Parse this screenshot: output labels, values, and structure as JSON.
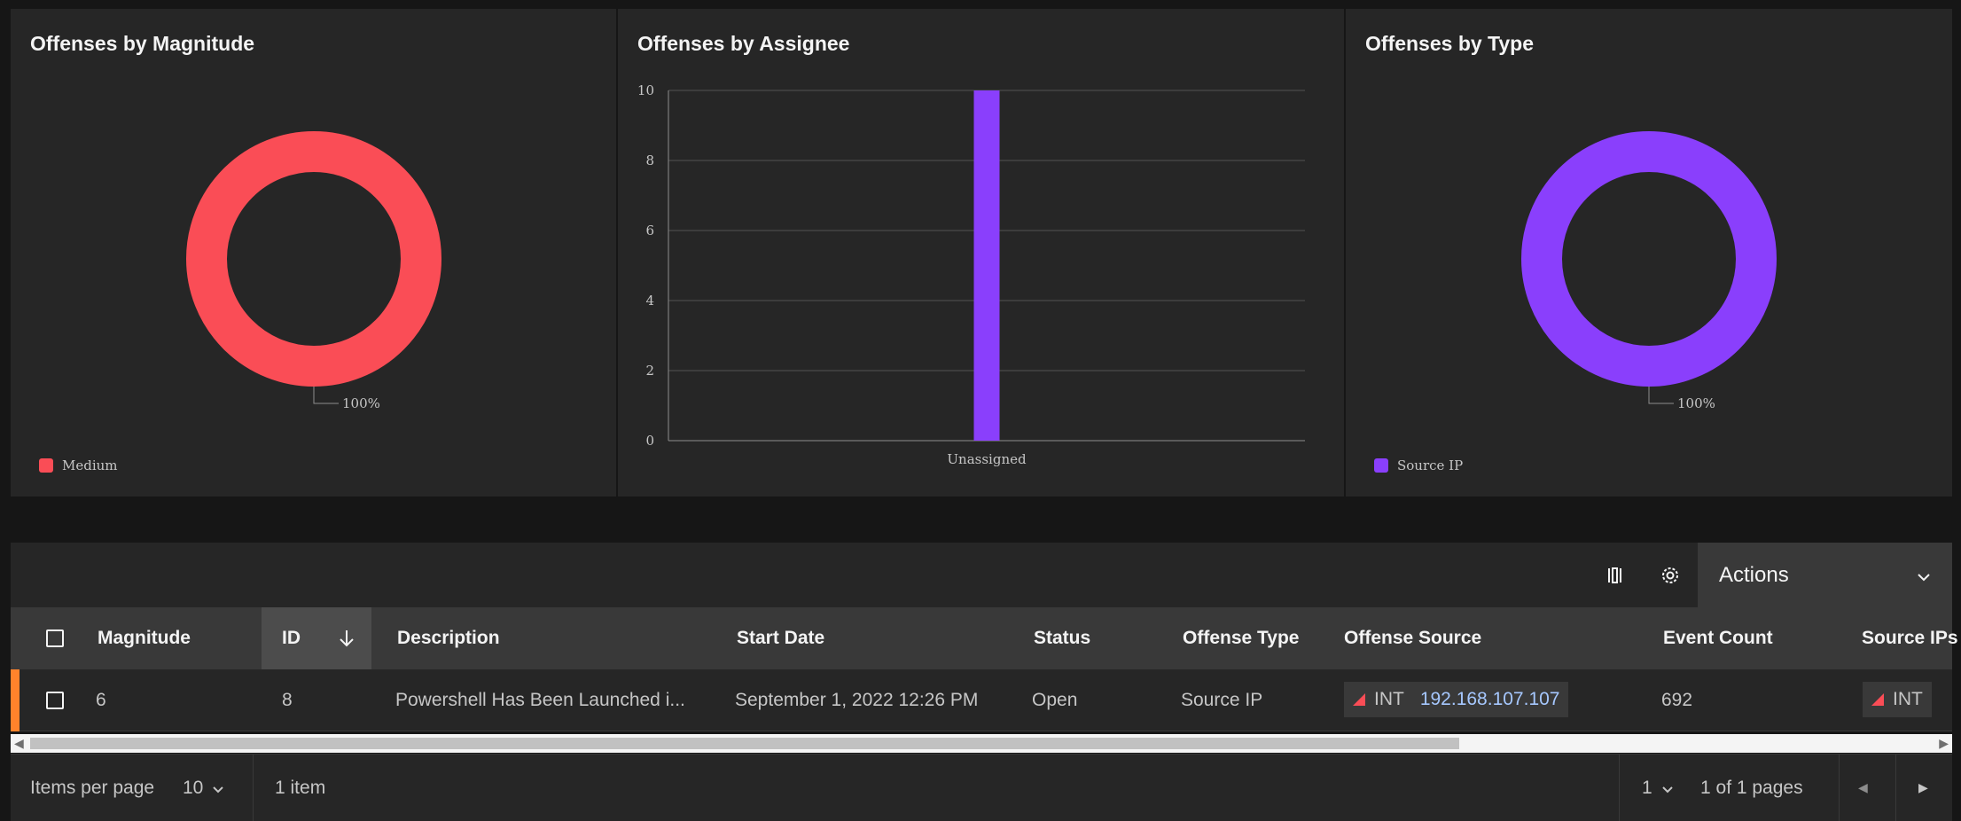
{
  "charts": {
    "magnitude": {
      "title": "Offenses by Magnitude",
      "pct_label": "100%",
      "legend": "Medium",
      "color": "#fa4d56"
    },
    "assignee": {
      "title": "Offenses by Assignee",
      "color": "#8a3ffc",
      "y_ticks": [
        "0",
        "2",
        "4",
        "6",
        "8",
        "10"
      ]
    },
    "type": {
      "title": "Offenses by Type",
      "pct_label": "100%",
      "legend": "Source IP",
      "color": "#8a3ffc"
    }
  },
  "chart_data": [
    {
      "type": "pie",
      "title": "Offenses by Magnitude",
      "categories": [
        "Medium"
      ],
      "values": [
        100
      ],
      "unit": "%",
      "legend_placement": "bottom-left"
    },
    {
      "type": "bar",
      "title": "Offenses by Assignee",
      "categories": [
        "Unassigned"
      ],
      "values": [
        10
      ],
      "ylim": [
        0,
        10
      ],
      "y_ticks": [
        0,
        2,
        4,
        6,
        8,
        10
      ],
      "grid": true
    },
    {
      "type": "pie",
      "title": "Offenses by Type",
      "categories": [
        "Source IP"
      ],
      "values": [
        100
      ],
      "unit": "%",
      "legend_placement": "bottom-left"
    }
  ],
  "toolbar": {
    "columns_icon": "column-settings-icon",
    "settings_icon": "gear-icon",
    "actions_label": "Actions",
    "actions_icon": "chevron-down-icon"
  },
  "table": {
    "headers": {
      "magnitude": "Magnitude",
      "id": "ID",
      "description": "Description",
      "start_date": "Start Date",
      "status": "Status",
      "offense_type": "Offense Type",
      "offense_source": "Offense Source",
      "event_count": "Event Count",
      "source_ips": "Source IPs"
    },
    "sort_icon": "arrow-down-icon",
    "rows": [
      {
        "magnitude": "6",
        "id": "8",
        "description": "Powershell Has Been Launched i...",
        "start_date": "September 1, 2022 12:26 PM",
        "status": "Open",
        "offense_type": "Source IP",
        "source_tag": "INT",
        "source_ip": "192.168.107.107",
        "event_count": "692",
        "source_ips_tag": "INT"
      }
    ]
  },
  "pagination": {
    "items_per_page_label": "Items per page",
    "items_per_page_value": "10",
    "item_count": "1 item",
    "page_value": "1",
    "page_of": "1 of 1 pages"
  },
  "colors": {
    "background": "#161616",
    "panel": "#262626",
    "header": "#393939",
    "row_marker": "#ff832b",
    "link": "#a6c8ff"
  }
}
